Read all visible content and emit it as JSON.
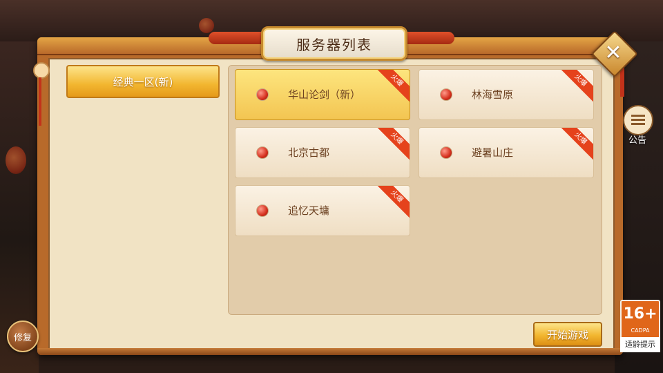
{
  "window": {
    "title": "服务器列表"
  },
  "regions": [
    {
      "label": "经典一区(新)",
      "selected": true
    }
  ],
  "servers": [
    {
      "name": "华山论剑（新）",
      "badge": "火爆",
      "selected": true
    },
    {
      "name": "林海雪原",
      "badge": "火爆",
      "selected": false
    },
    {
      "name": "北京古都",
      "badge": "火爆",
      "selected": false
    },
    {
      "name": "避暑山庄",
      "badge": "火爆",
      "selected": false
    },
    {
      "name": "追忆天墉",
      "badge": "火爆",
      "selected": false
    }
  ],
  "buttons": {
    "close_icon": "close-x-icon",
    "notice_label": "公告",
    "repair_label": "修复",
    "start_label": "开始游戏"
  },
  "rating": {
    "age": "16+",
    "org": "CADPA",
    "tip": "适龄提示"
  },
  "colors": {
    "accent": "#f2b630",
    "hot_badge": "#e5421c",
    "frame": "#b86a2a"
  }
}
